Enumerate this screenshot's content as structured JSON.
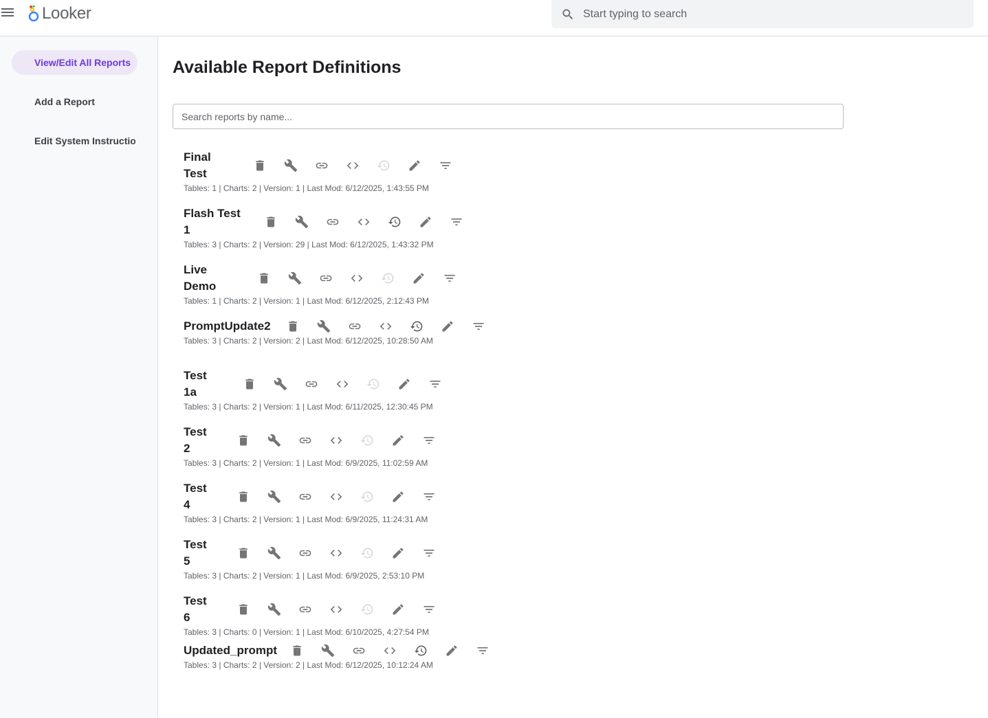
{
  "app": {
    "name": "Looker"
  },
  "topbar": {
    "search_placeholder": "Start typing to search"
  },
  "sidebar": {
    "items": [
      {
        "label": "View/Edit All Reports",
        "active": true
      },
      {
        "label": "Add a Report",
        "active": false
      },
      {
        "label": "Edit System Instructions",
        "active": false
      }
    ]
  },
  "main": {
    "title": "Available Report Definitions",
    "search_placeholder": "Search reports by name...",
    "reports": [
      {
        "name_lines": [
          "Final",
          "Test"
        ],
        "meta": "Tables: 1 | Charts: 2 | Version: 1 | Last Mod: 6/12/2025, 1:43:55 PM",
        "history_enabled": false
      },
      {
        "name_lines": [
          "Flash Test",
          "1"
        ],
        "meta": "Tables: 3 | Charts: 2 | Version: 29 | Last Mod: 6/12/2025, 1:43:32 PM",
        "history_enabled": true
      },
      {
        "name_lines": [
          "Live",
          "Demo"
        ],
        "meta": "Tables: 1 | Charts: 2 | Version: 1 | Last Mod: 6/12/2025, 2:12:43 PM",
        "history_enabled": false
      },
      {
        "name_lines": [
          "PromptUpdate2"
        ],
        "meta": "Tables: 3 | Charts: 2 | Version: 2 | Last Mod: 6/12/2025, 10:28:50 AM",
        "history_enabled": true
      },
      {
        "name_lines": [
          "Test",
          "1a"
        ],
        "meta": "Tables: 3 | Charts: 2 | Version: 1 | Last Mod: 6/11/2025, 12:30:45 PM",
        "history_enabled": false
      },
      {
        "name_lines": [
          "Test",
          "2"
        ],
        "meta": "Tables: 3 | Charts: 2 | Version: 1 | Last Mod: 6/9/2025, 11:02:59 AM",
        "history_enabled": false
      },
      {
        "name_lines": [
          "Test",
          "4"
        ],
        "meta": "Tables: 3 | Charts: 2 | Version: 1 | Last Mod: 6/9/2025, 11:24:31 AM",
        "history_enabled": false
      },
      {
        "name_lines": [
          "Test",
          "5"
        ],
        "meta": "Tables: 3 | Charts: 2 | Version: 1 | Last Mod: 6/9/2025, 2:53:10 PM",
        "history_enabled": false
      },
      {
        "name_lines": [
          "Test",
          "6"
        ],
        "meta": "Tables: 3 | Charts: 0 | Version: 1 | Last Mod: 6/10/2025, 4:27:54 PM",
        "history_enabled": false
      },
      {
        "name_lines": [
          "Updated_prompt"
        ],
        "meta": "Tables: 3 | Charts: 2 | Version: 2 | Last Mod: 6/12/2025, 10:12:24 AM",
        "history_enabled": true
      }
    ],
    "report_actions": [
      "delete-icon",
      "wrench-icon",
      "link-icon",
      "code-icon",
      "history-icon",
      "pencil-icon",
      "filter-icon"
    ]
  },
  "colors": {
    "accent": "#6e3bd6",
    "active_nav_bg": "#ede7f6",
    "icon": "#757575",
    "icon_disabled": "#d8d8d8"
  }
}
